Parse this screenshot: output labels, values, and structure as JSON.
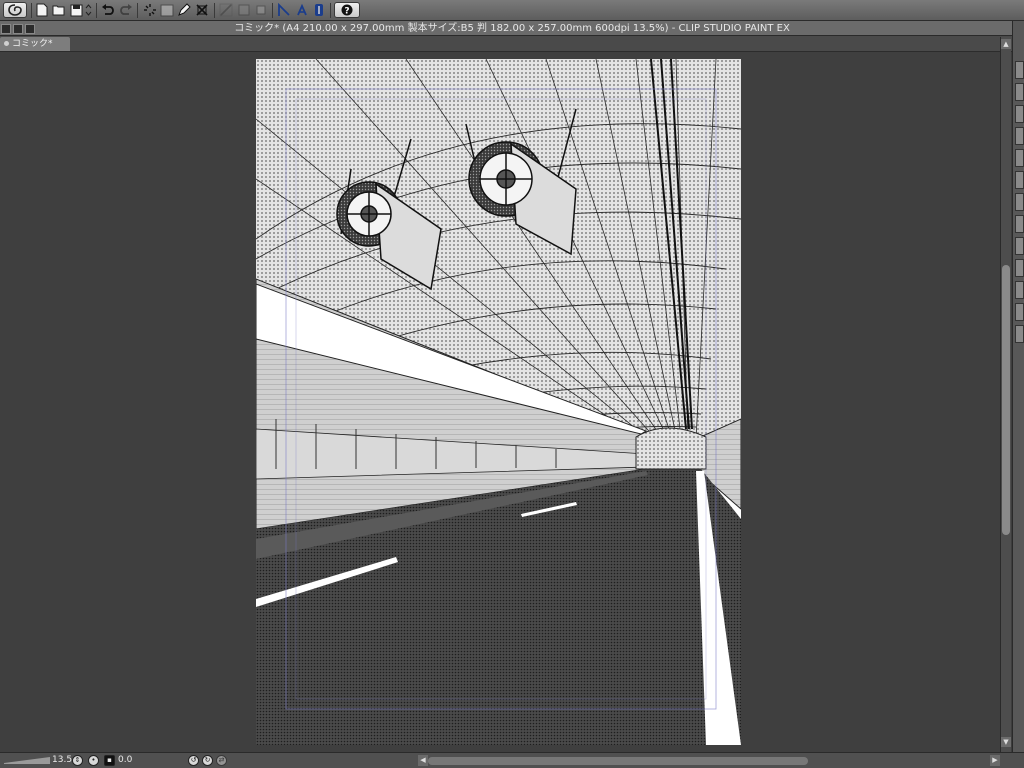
{
  "toolbar": {
    "icons": [
      "app-menu-icon",
      "new-file-icon",
      "open-file-icon",
      "save-icon",
      "undo-icon",
      "redo-icon",
      "transform-icon",
      "fit-icon",
      "pen-icon",
      "clear-icon",
      "snap-ruler-icon",
      "snap-guide-icon",
      "snap-perspective-icon",
      "help-icon"
    ]
  },
  "window": {
    "title": "コミック* (A4 210.00 x 297.00mm 製本サイズ:B5 判 182.00 x 257.00mm 600dpi 13.5%)  - CLIP STUDIO PAINT EX"
  },
  "tabs": [
    {
      "label": "コミック*"
    }
  ],
  "status": {
    "zoom": "13.5",
    "rotation": "0.0"
  },
  "colors": {
    "workspace_bg": "#3f3f3f",
    "page_bg": "#ffffff"
  }
}
